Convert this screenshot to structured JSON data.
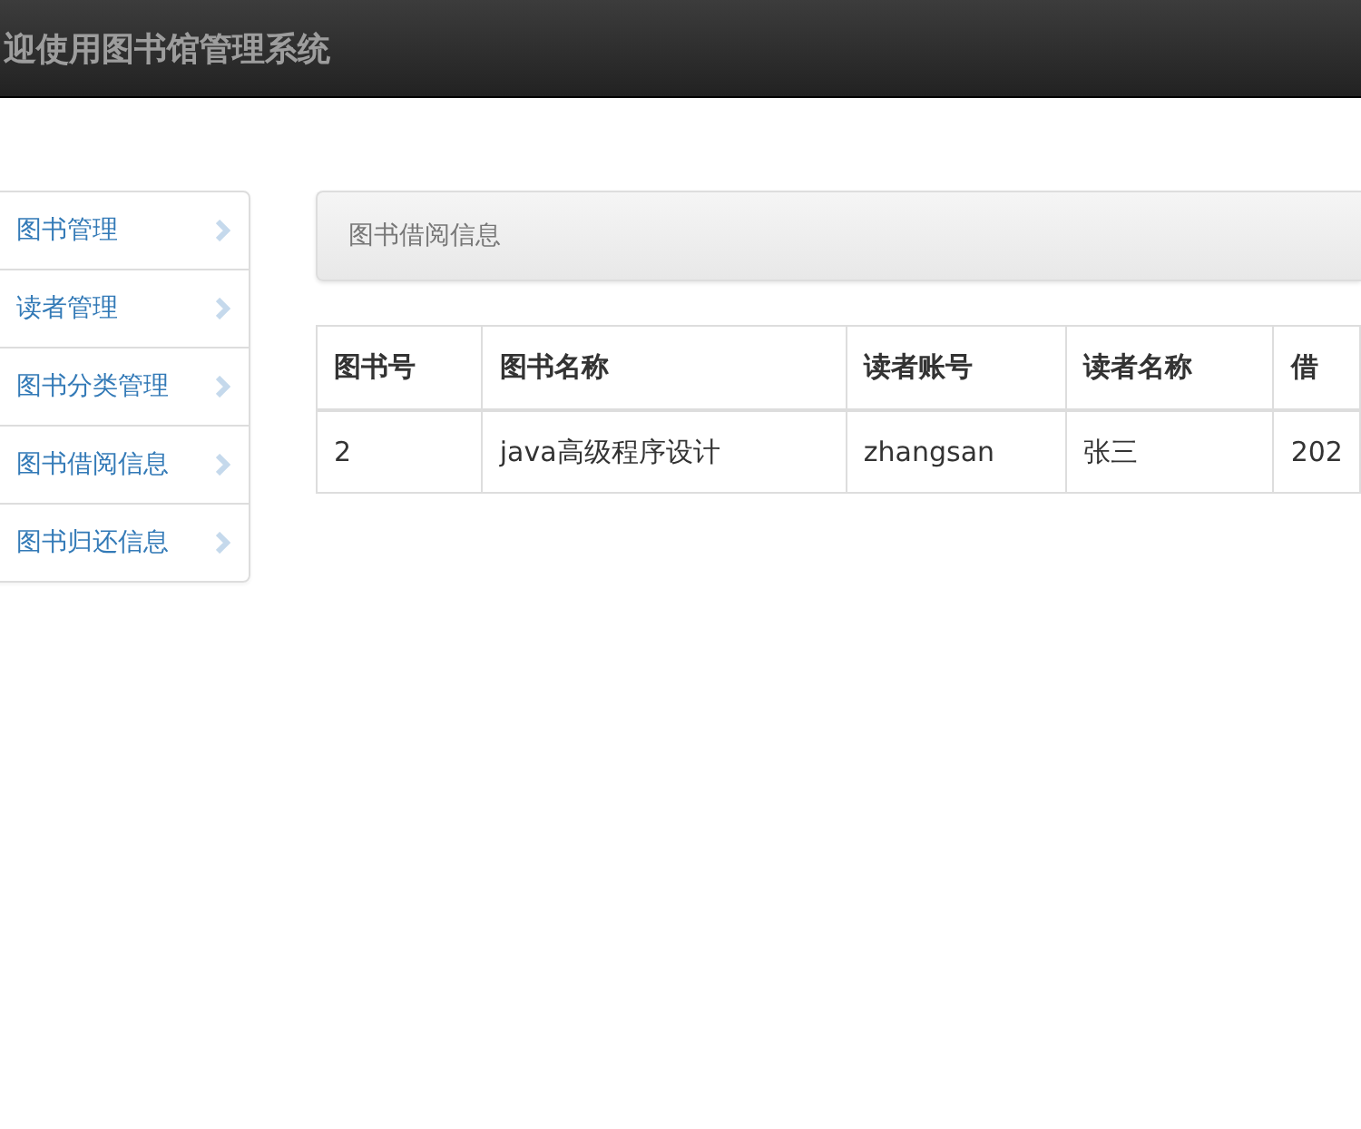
{
  "header": {
    "title": "迎使用图书馆管理系统"
  },
  "sidebar": {
    "items": [
      {
        "label": "图书管理"
      },
      {
        "label": "读者管理"
      },
      {
        "label": "图书分类管理"
      },
      {
        "label": "图书借阅信息"
      },
      {
        "label": "图书归还信息"
      }
    ]
  },
  "panel": {
    "title": "图书借阅信息"
  },
  "table": {
    "columns": [
      "图书号",
      "图书名称",
      "读者账号",
      "读者名称",
      "借"
    ],
    "rows": [
      [
        "2",
        "java高级程序设计",
        "zhangsan",
        "张三",
        "202"
      ]
    ]
  }
}
